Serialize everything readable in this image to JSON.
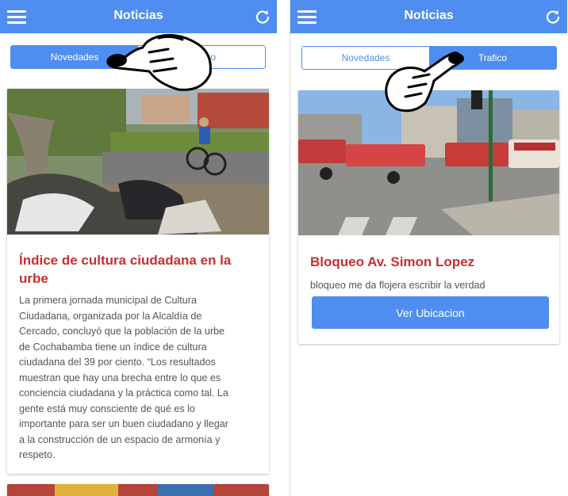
{
  "left_screen": {
    "navbar": {
      "title": "Noticias",
      "menu_icon": "hamburger-menu-icon",
      "refresh_icon": "refresh-icon"
    },
    "tabs": [
      {
        "label": "Novedades",
        "active": true
      },
      {
        "label": "Trafico",
        "active": false
      }
    ],
    "card": {
      "image": "photo of litter beside a street with a child on a bicycle",
      "title": "Índice de cultura ciudadana en la urbe",
      "body_lines": [
        "La primera jornada municipal de Cultura",
        "Ciudadana, organizada por la Alcaldía de",
        "Cercado, concluyó que la población de la urbe",
        "de Cochabamba tiene un índice de cultura",
        "ciudadana del 39 por ciento.  “Los resultados",
        "muestran que hay una brecha entre lo que es",
        "conciencia ciudadana y la práctica como tal. La",
        "gente está muy consciente de qué es lo",
        "importante para ser un buen ciudadano y llegar",
        "a la construcción de un espacio de armonía y",
        "respeto."
      ]
    }
  },
  "right_screen": {
    "navbar": {
      "title": "Noticias",
      "menu_icon": "hamburger-menu-icon",
      "refresh_icon": "refresh-icon"
    },
    "tabs": [
      {
        "label": "Novedades",
        "active": false
      },
      {
        "label": "Trafico",
        "active": true
      }
    ],
    "card": {
      "image": "photo of a blocked city intersection with buses",
      "title": "Bloqueo Av. Simon Lopez",
      "body": "bloqueo me da flojera escribir la verdad",
      "button_label": "Ver Ubicacion"
    }
  },
  "overlays": {
    "gesture_icon": "tap-hand-icon"
  },
  "colors": {
    "primary": "#4f8ef0",
    "title_red": "#c62f2f",
    "text_gray": "#555555"
  }
}
